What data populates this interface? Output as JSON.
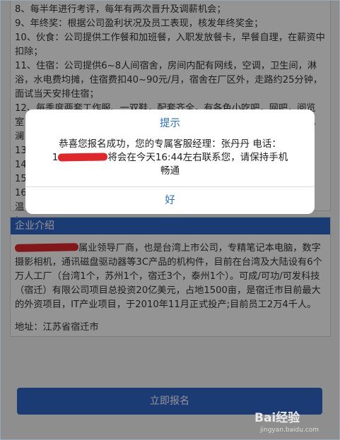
{
  "intro_lines": [
    "8、每半年进行考评，每年有两次晋升及调薪机会；",
    "9、年终奖：根据公司盈利状况及员工表现，核发年终奖金；",
    "10、伙食：公司提供工作餐和加班餐，入职发放餐卡，早餐自理，在薪资中扣除；",
    "11、住宿：公司提供6~8人间宿舍，房间内配有网线，空调，卫生间，淋浴，水电费均摊，住宿费扣40~90元/月，宿舍在厂区外，走路约25分钟，面试当天安排住宿；",
    "12、每季度两套工作服、一双鞋，配套齐全，有各色小吃吧，网吧，阅览室，篮球场，购物商城，KTV，大型超市，银行等，年终奖办聚餐，烧烤，",
    "澜",
    "13",
    "14",
    "15",
    "16",
    "温                                                                                    常",
    "加"
  ],
  "company": {
    "header": "企业介绍",
    "desc_after_redaction": "属业领导厂商，也是台湾上市公司，专精笔记本电脑，数字摄影相机，通讯磁盘驱动器等3C产品的机构件，目前在台湾及大陆设有6个万人工厂（台湾1个，苏州1个，宿迁3个，泰州1个）。可成/可功/可发科技（宿迁）有限公司项目总投资20亿美元，占地1500亩，是宿迁市目前最大的外资项目，IT产业项目，于2010年11月正式投产;目前员工2万4千人。",
    "address": "地址：江苏省宿迁市"
  },
  "apply_button": "立即报名",
  "alert": {
    "title": "提示",
    "line1": "恭喜您报名成功，您的专属客服经理：张丹丹 电话：",
    "phone_prefix": "1",
    "line2_rest": "将会在今天16:44左右联系您，请保持手机",
    "line3": "畅通",
    "ok": "好"
  },
  "watermark": {
    "brand": "Bai经验",
    "url": "jingyan.baidu.com"
  },
  "colors": {
    "accent": "#2f66c8",
    "alert_text": "#2a6fd6",
    "redaction": "#e0262a"
  }
}
